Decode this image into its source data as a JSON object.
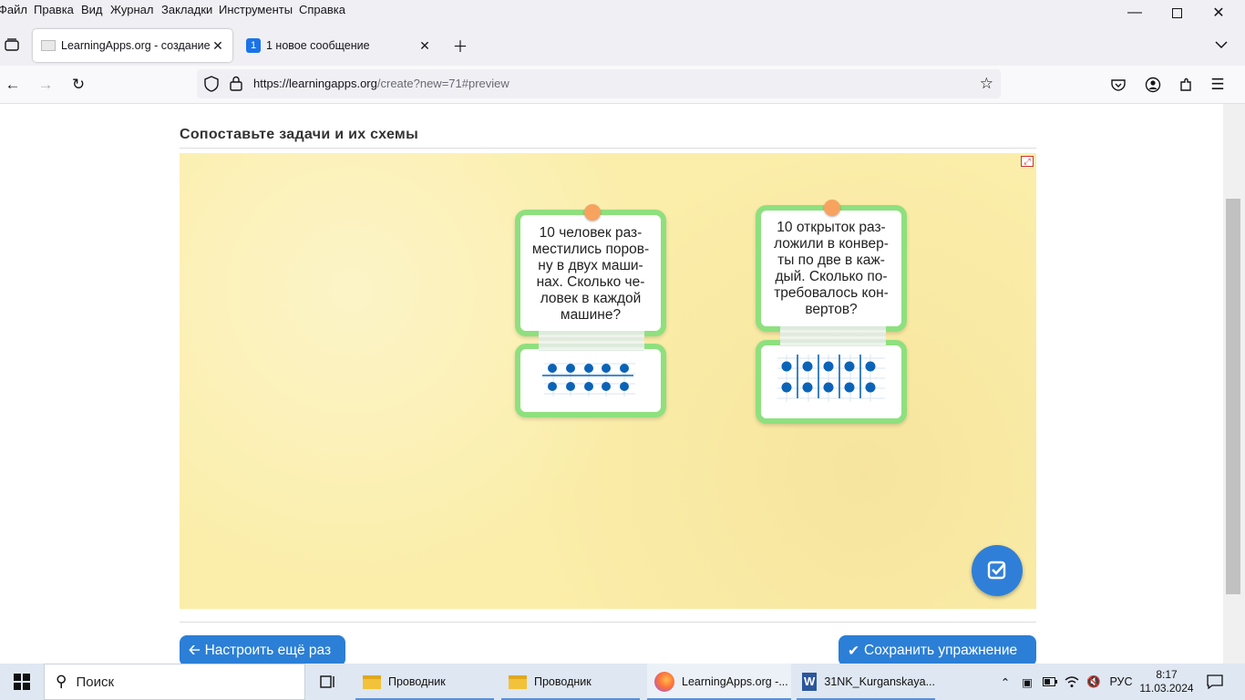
{
  "menu": [
    "Файл",
    "Правка",
    "Вид",
    "Журнал",
    "Закладки",
    "Инструменты",
    "Справка"
  ],
  "tabs": [
    {
      "title": "LearningApps.org - создание м",
      "active": true
    },
    {
      "title": "1 новое сообщение",
      "badge": "1",
      "active": false
    }
  ],
  "url": {
    "host": "https://learningapps.org",
    "path": "/create?new=71#preview"
  },
  "page": {
    "title": "Сопоставьте задачи и их схемы"
  },
  "cards": [
    {
      "text": "10 человек раз-\nместились поров-\nну в двух маши-\nнах. Сколько че-\nловек в каждой\nмашине?",
      "scheme": "2 rows of 5 dots with horizontal divider"
    },
    {
      "text": "10 открыток раз-\nложили в конвер-\nты по две в каж-\nдый. Сколько по-\nтребовалось кон-\nвертов?",
      "scheme": "5 columns of 2 dots with vertical dividers"
    }
  ],
  "buttons": {
    "reconfigure": "Настроить ещё раз",
    "save": "Сохранить упражнение"
  },
  "taskbar": {
    "search": "Поиск",
    "items": [
      "Проводник",
      "Проводник",
      "LearningApps.org -...",
      "31NK_Kurganskaya..."
    ],
    "lang": "РУС",
    "time": "8:17",
    "date": "11.03.2024"
  },
  "colors": {
    "card_border": "#8ee07e",
    "pin": "#f7a35f",
    "accent": "#2b7fd6",
    "board": "#fbeeaa",
    "dot": "#0b63b8"
  }
}
